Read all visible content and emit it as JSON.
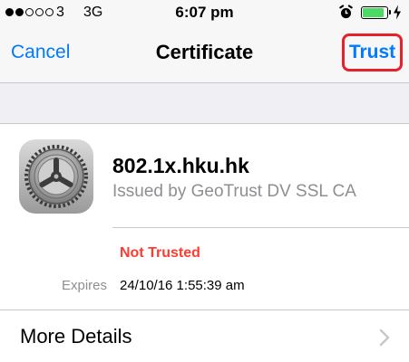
{
  "status_bar": {
    "signal_strength": 2,
    "signal_max": 5,
    "carrier": "3",
    "network": "3G",
    "time": "6:07 pm",
    "icons": [
      "alarm-icon",
      "battery-icon",
      "charging-bolt-icon"
    ],
    "battery_level": 0.9,
    "battery_color": "#4cd964"
  },
  "nav": {
    "cancel_label": "Cancel",
    "title": "Certificate",
    "trust_label": "Trust"
  },
  "certificate": {
    "icon": "gear-icon",
    "name": "802.1x.hku.hk",
    "issuer": "Issued by GeoTrust DV SSL CA",
    "status": "Not Trusted",
    "expires_label": "Expires",
    "expires_value": "24/10/16 1:55:39 am"
  },
  "more_details": {
    "label": "More Details",
    "icon": "chevron-right-icon"
  },
  "colors": {
    "accent": "#007aff",
    "danger": "#ff3b30",
    "highlight_border": "#e8202a"
  }
}
